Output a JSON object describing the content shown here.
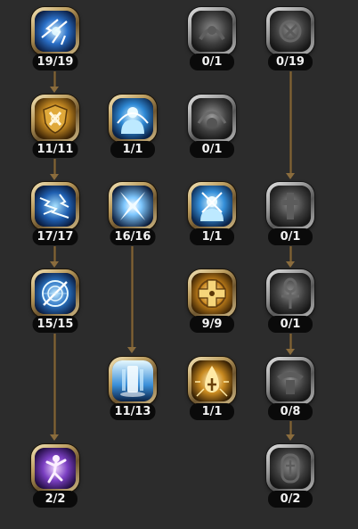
{
  "skills": [
    {
      "id": "lightning-burst",
      "count": "19/19",
      "state": "learned",
      "icon": "lightning-burst-icon"
    },
    {
      "id": "holy-shield",
      "count": "11/11",
      "state": "learned",
      "icon": "holy-shield-icon"
    },
    {
      "id": "chain-lightning",
      "count": "17/17",
      "state": "learned",
      "icon": "chain-lightning-icon"
    },
    {
      "id": "arcane-circle",
      "count": "15/15",
      "state": "learned",
      "icon": "arcane-circle-icon"
    },
    {
      "id": "spirit-figure",
      "count": "2/2",
      "state": "learned",
      "icon": "spirit-figure-icon"
    },
    {
      "id": "divine-guard",
      "count": "1/1",
      "state": "learned",
      "icon": "divine-guard-icon"
    },
    {
      "id": "cross-slash",
      "count": "16/16",
      "state": "learned",
      "icon": "cross-slash-icon"
    },
    {
      "id": "ice-pillar",
      "count": "11/13",
      "state": "learned",
      "icon": "ice-pillar-icon"
    },
    {
      "id": "locked-emblem-a",
      "count": "0/1",
      "state": "locked",
      "icon": "locked-emblem-icon"
    },
    {
      "id": "locked-orb",
      "count": "0/1",
      "state": "locked",
      "icon": "locked-orb-icon"
    },
    {
      "id": "frost-guard",
      "count": "1/1",
      "state": "learned",
      "icon": "frost-guard-icon"
    },
    {
      "id": "holy-cross",
      "count": "9/9",
      "state": "learned",
      "icon": "holy-cross-icon"
    },
    {
      "id": "sacred-flame",
      "count": "1/1",
      "state": "learned",
      "icon": "sacred-flame-icon"
    },
    {
      "id": "locked-rune",
      "count": "0/19",
      "state": "locked",
      "icon": "locked-rune-icon"
    },
    {
      "id": "locked-totem",
      "count": "0/1",
      "state": "locked",
      "icon": "locked-totem-icon"
    },
    {
      "id": "locked-ankh",
      "count": "0/1",
      "state": "locked",
      "icon": "locked-ankh-icon"
    },
    {
      "id": "locked-guardian",
      "count": "0/8",
      "state": "locked",
      "icon": "locked-guardian-icon"
    },
    {
      "id": "locked-tablet",
      "count": "0/2",
      "state": "locked",
      "icon": "locked-tablet-icon"
    }
  ],
  "colors": {
    "background": "#2c2c2c",
    "gold_frame": "#b99a5c",
    "grey_frame": "#9a9a9a",
    "connector": "#8a6c3d",
    "counter_bg": "#0a0a0a",
    "counter_text": "#f2f2f2"
  }
}
